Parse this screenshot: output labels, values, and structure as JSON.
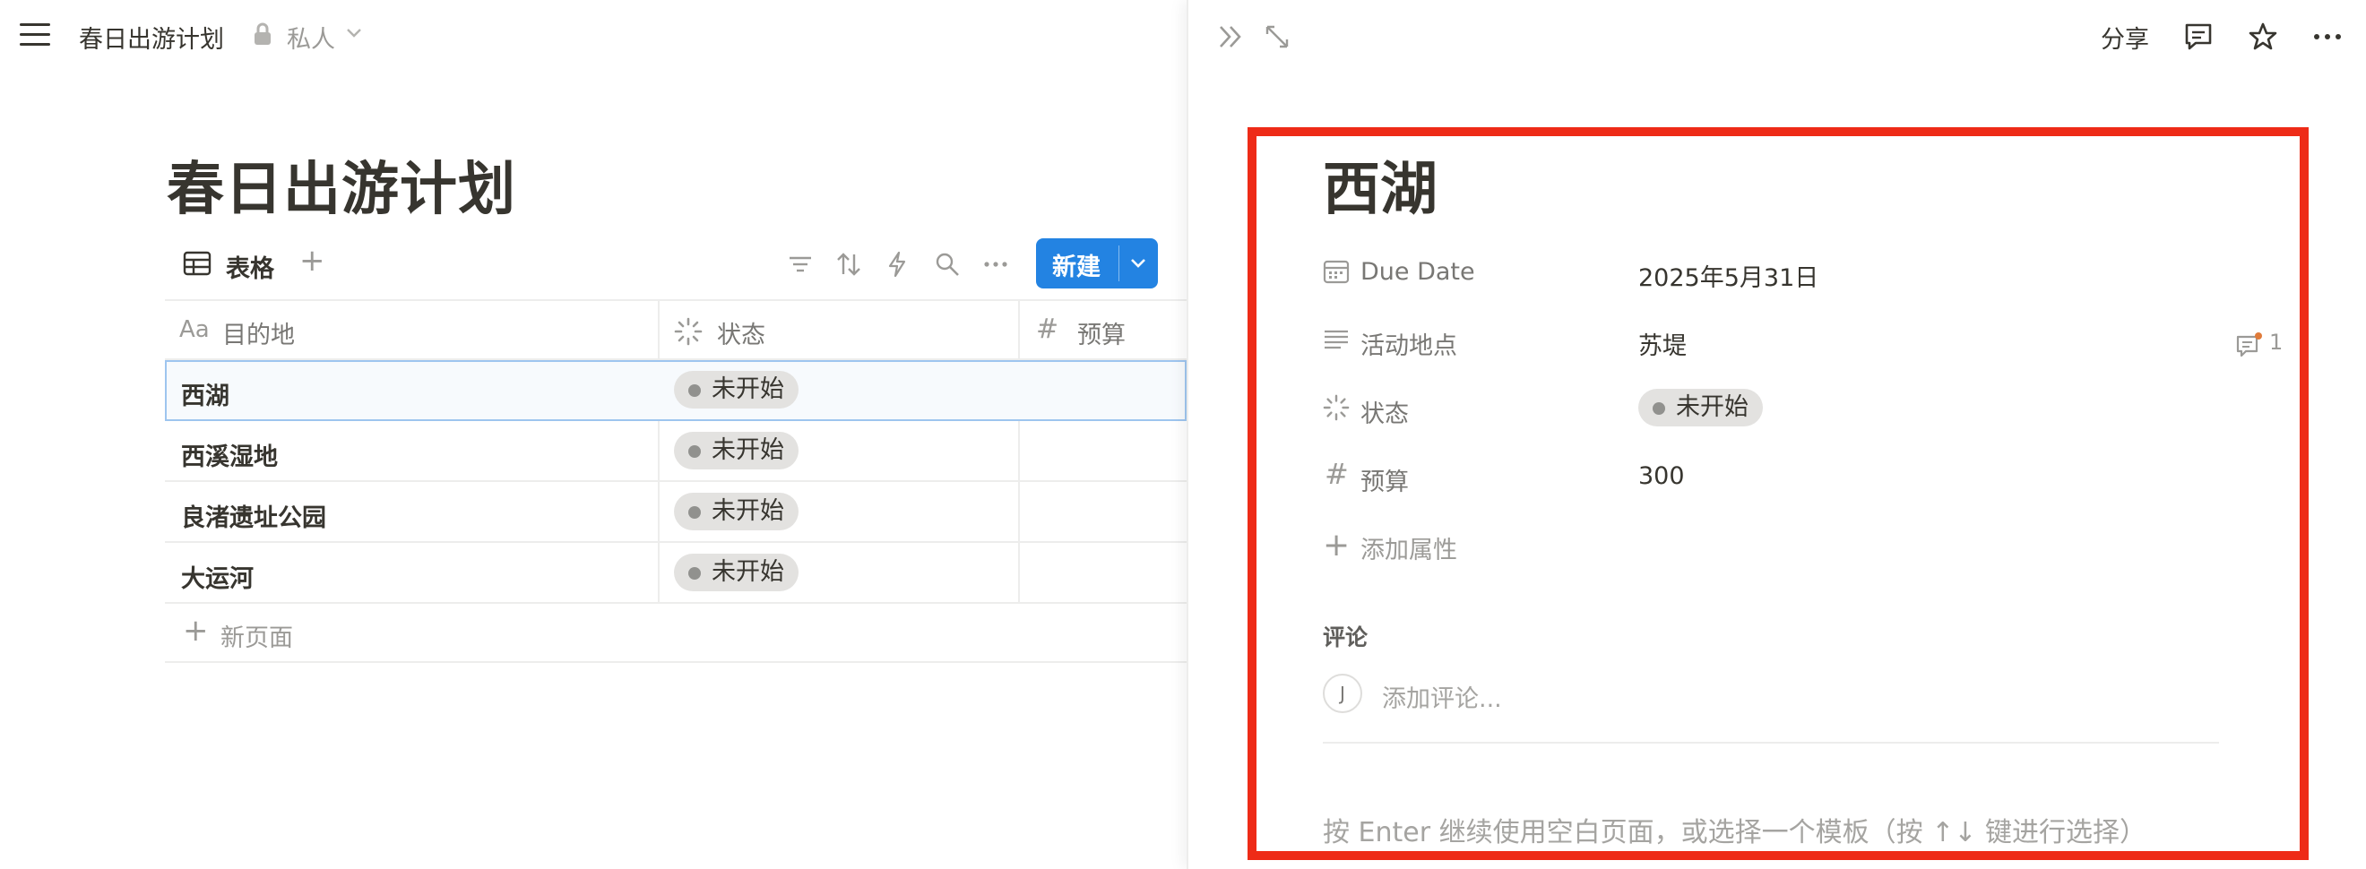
{
  "topbar": {
    "breadcrumb_title": "春日出游计划",
    "privacy": "私人"
  },
  "page": {
    "title": "春日出游计划"
  },
  "view": {
    "tab_label": "表格",
    "new_button": "新建"
  },
  "table": {
    "columns": [
      {
        "icon_text": "Aa",
        "label": "目的地"
      },
      {
        "icon": "status-icon",
        "label": "状态"
      },
      {
        "icon_text": "#",
        "label": "预算"
      }
    ],
    "rows": [
      {
        "name": "西湖",
        "status": "未开始"
      },
      {
        "name": "西溪湿地",
        "status": "未开始"
      },
      {
        "name": "良渚遗址公园",
        "status": "未开始"
      },
      {
        "name": "大运河",
        "status": "未开始"
      }
    ],
    "new_page": "新页面"
  },
  "detail": {
    "share": "分享",
    "title": "西湖",
    "properties": [
      {
        "icon": "calendar-icon",
        "name": "Due Date",
        "value": "2025年5月31日"
      },
      {
        "icon": "text-lines-icon",
        "name": "活动地点",
        "value": "苏堤",
        "comment_count": "1"
      },
      {
        "icon": "status-icon",
        "name": "状态",
        "value": "未开始"
      },
      {
        "icon_text": "#",
        "name": "预算",
        "value": "300"
      }
    ],
    "add_property": "添加属性",
    "comments_label": "评论",
    "avatar_initial": "J",
    "add_comment_placeholder": "添加评论...",
    "hint": "按 Enter 继续使用空白页面，或选择一个模板（按 ↑↓ 键进行选择）"
  },
  "colors": {
    "accent": "#2383e2",
    "highlight": "#ee2b17",
    "pill_bg": "#e3e2e0"
  }
}
